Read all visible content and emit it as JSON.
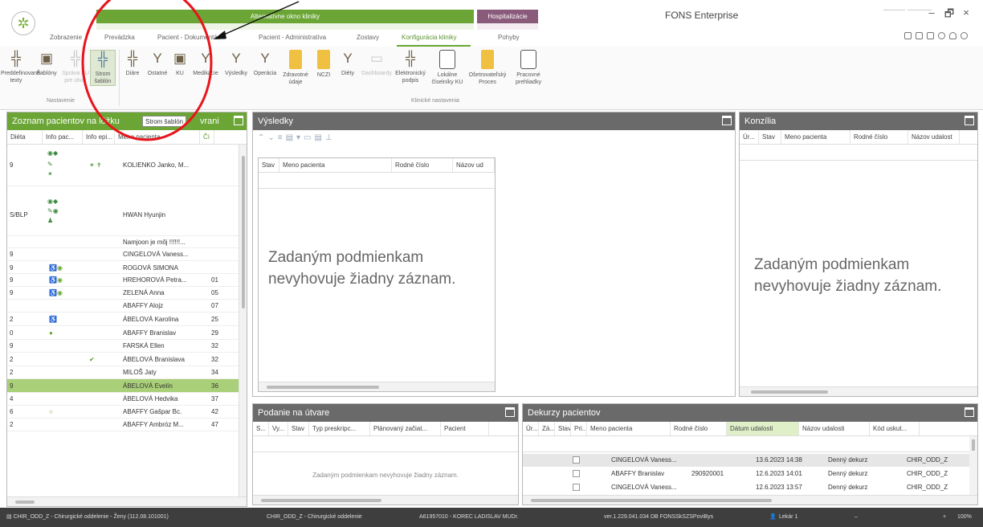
{
  "window": {
    "app_title": "FONS Enterprise",
    "context_green": "Alternatívne okno kliniky",
    "context_purple": "Hospitalizácie",
    "icons": {
      "minimize": "–",
      "maximize": "🗗",
      "close": "×"
    }
  },
  "tabs": [
    {
      "label": "Zobrazenie"
    },
    {
      "label": "Prevádzka"
    },
    {
      "label": "Pacient - Dokumentácia"
    },
    {
      "label": "Pacient - Administratíva"
    },
    {
      "label": "Zostavy"
    },
    {
      "label": "Konfigurácia kliniky"
    },
    {
      "label": "Pohyby"
    }
  ],
  "ribbon": {
    "buttons": [
      {
        "label": "Preddefinované texty",
        "icon": "tree-config-icon"
      },
      {
        "label": "Šablóny",
        "icon": "template-icon"
      },
      {
        "label": "Správa KU pre útvar",
        "icon": "ku-admin-icon"
      },
      {
        "label": "Strom šablón",
        "icon": "template-tree-icon"
      },
      {
        "label": "Diáre",
        "icon": "diary-icon"
      },
      {
        "label": "Ostatné",
        "icon": "other-icon"
      },
      {
        "label": "KU",
        "icon": "ku-icon"
      },
      {
        "label": "Medikácie",
        "icon": "medication-icon"
      },
      {
        "label": "Výsledky",
        "icon": "results-icon"
      },
      {
        "label": "Operácia",
        "icon": "operation-icon"
      },
      {
        "label": "Zdravotné údaje",
        "icon": "health-data-icon"
      },
      {
        "label": "NCZI",
        "icon": "ncz-icon"
      },
      {
        "label": "Diéty",
        "icon": "diet-icon"
      },
      {
        "label": "Dashboardy",
        "icon": "dashboard-icon"
      },
      {
        "label": "Elektronický podpis",
        "icon": "e-signature-icon"
      },
      {
        "label": "Lokálne číselníky KU",
        "icon": "local-codelist-icon"
      },
      {
        "label": "Ošetrovateľský Proces",
        "icon": "nursing-process-icon"
      },
      {
        "label": "Pracovné prehliadky",
        "icon": "work-views-icon"
      }
    ],
    "group_nastavenie": "Nastavenie",
    "group_klinicke": "Klinické nastavenia"
  },
  "patient_list": {
    "title": "Zoznam pacientov na lôžku",
    "tooltip": "Strom šablón",
    "title_suffix": "vrani",
    "columns": [
      "Diéta",
      "Info pac...",
      "Info epi...",
      "Meno pacienta",
      "Čí"
    ],
    "rows": [
      {
        "dieta": "9",
        "info": "",
        "epi": "✶ ✝",
        "name": "KOLIENKO Janko, M...",
        "c": ""
      },
      {
        "dieta": "S/BLP",
        "info": "",
        "epi": "",
        "name": "HWAN Hyunjin",
        "c": ""
      },
      {
        "dieta": "",
        "info": "",
        "epi": "",
        "name": "Namjoon je môj !!!!!!...",
        "c": ""
      },
      {
        "dieta": "9",
        "info": "",
        "epi": "",
        "name": "CINGELOVÁ Vaness...",
        "c": ""
      },
      {
        "dieta": "9",
        "info": "♿◉",
        "epi": "",
        "name": "ROGOVÁ SIMONA",
        "c": ""
      },
      {
        "dieta": "9",
        "info": "♿◉",
        "epi": "",
        "name": "HREHOROVÁ Petra...",
        "c": "01"
      },
      {
        "dieta": "9",
        "info": "♿◉",
        "epi": "",
        "name": "ZELENÁ Anna",
        "c": "05"
      },
      {
        "dieta": "",
        "info": "",
        "epi": "",
        "name": "ABAFFY Alojz",
        "c": "07"
      },
      {
        "dieta": "2",
        "info": "♿",
        "epi": "",
        "name": "ÁBELOVÁ Karolína",
        "c": "25"
      },
      {
        "dieta": "0",
        "info": "●",
        "epi": "",
        "name": "ABAFFY Branislav",
        "c": "29"
      },
      {
        "dieta": "9",
        "info": "",
        "epi": "",
        "name": "FARSKÁ Ellen",
        "c": "32"
      },
      {
        "dieta": "2",
        "info": "",
        "epi": "✔",
        "name": "ÁBELOVÁ Branislava",
        "c": "32"
      },
      {
        "dieta": "2",
        "info": "",
        "epi": "",
        "name": "MILOŠ Jaty",
        "c": "34"
      },
      {
        "dieta": "9",
        "info": "",
        "epi": "",
        "name": "ÁBELOVÁ Evelín",
        "c": "36"
      },
      {
        "dieta": "4",
        "info": "",
        "epi": "",
        "name": "ÁBELOVÁ Hedvika",
        "c": "37"
      },
      {
        "dieta": "6",
        "info": "○",
        "epi": "",
        "name": "ABAFFY Gašpar Bc.",
        "c": "42"
      },
      {
        "dieta": "2",
        "info": "",
        "epi": "",
        "name": "ABAFFY Ambróz M...",
        "c": "47"
      }
    ],
    "selected_row": 13
  },
  "results": {
    "title": "Výsledky",
    "columns": [
      "Stav",
      "Meno pacienta",
      "Rodné číslo",
      "Názov ud"
    ],
    "empty": "Zadaným podmienkam nevyhovuje žiadny záznam."
  },
  "konzilia": {
    "title": "Konzília",
    "columns": [
      "Úr...",
      "Stav",
      "Meno pacienta",
      "Rodné číslo",
      "Názov udalost"
    ],
    "empty": "Zadaným podmienkam nevyhovuje žiadny záznam."
  },
  "podanie": {
    "title": "Podanie na útvare",
    "columns": [
      "S...",
      "Vy...",
      "Stav",
      "Typ preskripc...",
      "Plánovaný začiat...",
      "Pacient"
    ],
    "empty": "Zadaným podmienkam nevyhovuje žiadny záznam."
  },
  "dekurzy": {
    "title": "Dekurzy pacientov",
    "columns": [
      "Úr...",
      "Zá...",
      "Stav",
      "Pri...",
      "Meno pacienta",
      "Rodné číslo",
      "Dátum udalosti",
      "Názov udalosti",
      "Kód uskut..."
    ],
    "rows": [
      {
        "name": "CINGELOVÁ Vaness...",
        "rc": "",
        "date": "13.6.2023 14:38",
        "event": "Denný dekurz",
        "code": "CHIR_ODD_Z"
      },
      {
        "name": "ABAFFY Branislav",
        "rc": "290920001",
        "date": "12.6.2023 14:01",
        "event": "Denný dekurz",
        "code": "CHIR_ODD_Z"
      },
      {
        "name": "CINGELOVÁ Vaness...",
        "rc": "",
        "date": "12.6.2023 13:57",
        "event": "Denný dekurz",
        "code": "CHIR_ODD_Z"
      }
    ]
  },
  "status_bar": {
    "dept": "CHIR_ODD_Z - Chirurgické oddelenie - Ženy (112.08.101001)",
    "dept2": "CHIR_ODD_Z - Chirurgické oddelenie",
    "doctor": "A61957010 - KOREC LADISLAV MUDr.",
    "version": "ver.1.229.041.034 DB FONSSkSZSPoviBys",
    "user": "Lekár 1",
    "zoom": "100%"
  },
  "colors": {
    "accent_green": "#6aa535",
    "header_gray": "#6a6a6a",
    "hospital_purple": "#8a5a7a",
    "annotation_red": "#e8141b"
  }
}
